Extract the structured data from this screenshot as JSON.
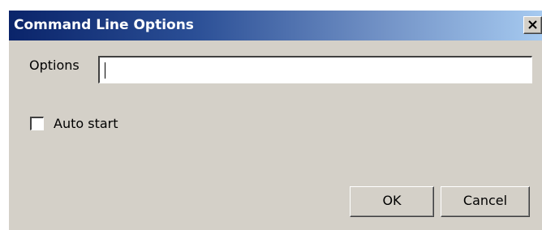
{
  "window": {
    "title": "Command Line Options",
    "close_icon": "close-x-icon"
  },
  "options": {
    "label": "Options",
    "value": ""
  },
  "auto_start": {
    "label": "Auto start",
    "checked": false
  },
  "buttons": {
    "ok_label": "OK",
    "cancel_label": "Cancel"
  },
  "colors": {
    "titlebar_start": "#0a246a",
    "titlebar_end": "#a6caf0",
    "dialog_face": "#d4d0c8"
  }
}
